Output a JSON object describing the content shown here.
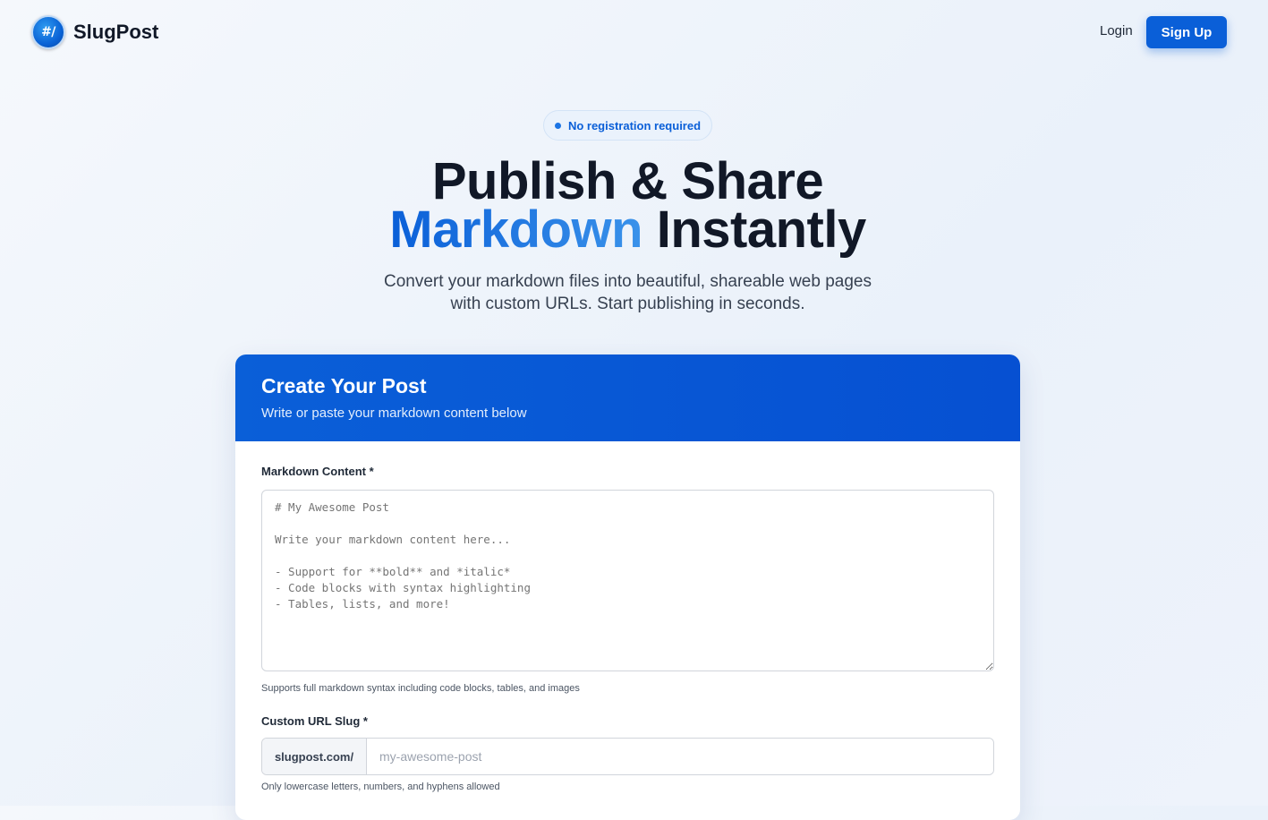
{
  "brand": {
    "logo_text": "#/",
    "name": "SlugPost"
  },
  "nav": {
    "login_label": "Login",
    "signup_label": "Sign Up"
  },
  "hero": {
    "pill_text": "No registration required",
    "title_line1": "Publish & Share",
    "title_accent": "Markdown",
    "title_rest": "Instantly",
    "subtitle_line1": "Convert your markdown files into beautiful, shareable web pages",
    "subtitle_line2": "with custom URLs. Start publishing in seconds."
  },
  "form": {
    "title": "Create Your Post",
    "subtitle": "Write or paste your markdown content below",
    "content_label": "Markdown Content *",
    "content_placeholder": "# My Awesome Post\n\nWrite your markdown content here...\n\n- Support for **bold** and *italic*\n- Code blocks with syntax highlighting\n- Tables, lists, and more!",
    "content_help": "Supports full markdown syntax including code blocks, tables, and images",
    "slug_label": "Custom URL Slug *",
    "slug_prefix": "slugpost.com/",
    "slug_placeholder": "my-awesome-post",
    "slug_help": "Only lowercase letters, numbers, and hyphens allowed"
  },
  "colors": {
    "accent": "#0a5fd8",
    "text": "#111827",
    "muted": "#374151"
  }
}
